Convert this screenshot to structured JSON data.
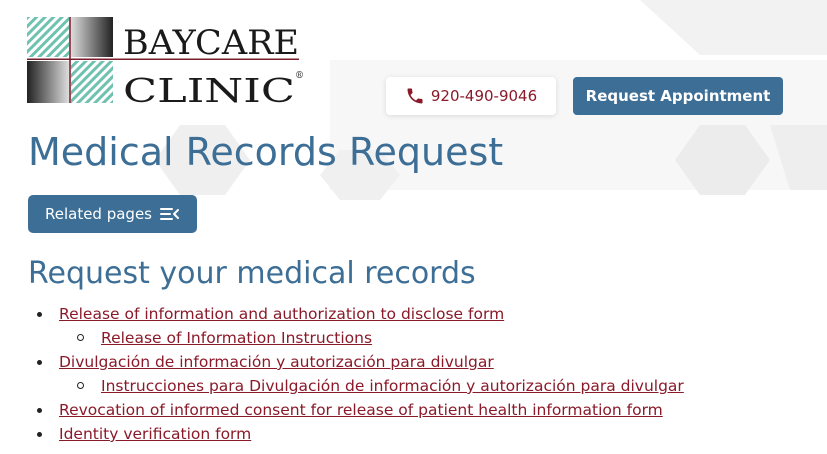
{
  "brand": {
    "name_top": "BAYCARE",
    "name_bottom": "CLINIC",
    "mark": "®"
  },
  "header": {
    "phone_icon": "phone-icon",
    "phone_number": "920-490-9046",
    "appointment_label": "Request Appointment"
  },
  "page": {
    "title": "Medical Records Request",
    "related_label": "Related pages",
    "related_icon": "menu-collapse-icon"
  },
  "section": {
    "heading": "Request your medical records",
    "items": [
      {
        "label": "Release of information and authorization to disclose form",
        "sub": "Release of Information Instructions"
      },
      {
        "label": "Divulgación de información y autorización para divulgar",
        "sub": "Instrucciones para Divulgación de información y autorización para divulgar"
      },
      {
        "label": "Revocation of informed consent for release of patient health information form"
      },
      {
        "label": "Identity verification form"
      }
    ]
  },
  "colors": {
    "primary_blue": "#3d6e96",
    "link_red": "#8a1a2a",
    "logo_teal": "#6fc1b0",
    "logo_maroon": "#7a1e2e"
  }
}
